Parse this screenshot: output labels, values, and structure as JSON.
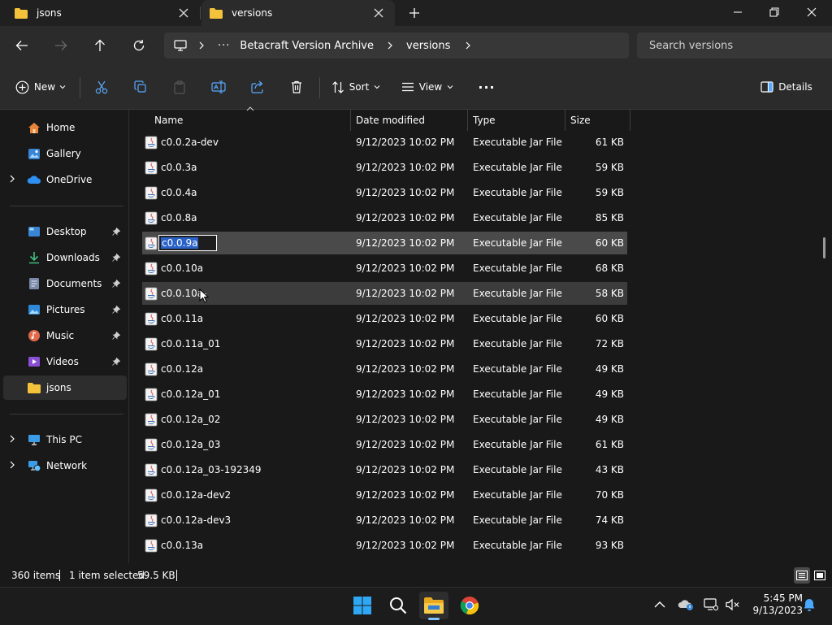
{
  "tabs": [
    {
      "label": "jsons",
      "active": false
    },
    {
      "label": "versions",
      "active": true
    }
  ],
  "address": {
    "breadcrumbs": [
      "Betacraft Version Archive",
      "versions"
    ],
    "overflow": "···"
  },
  "search": {
    "placeholder": "Search versions"
  },
  "commandbar": {
    "new_label": "New",
    "sort_label": "Sort",
    "view_label": "View",
    "more_label": "···",
    "details_label": "Details"
  },
  "sidebar": {
    "top": [
      {
        "label": "Home",
        "icon": "home-icon"
      },
      {
        "label": "Gallery",
        "icon": "gallery-icon"
      },
      {
        "label": "OneDrive",
        "icon": "onedrive-icon"
      }
    ],
    "pinned": [
      {
        "label": "Desktop",
        "icon": "desktop-icon"
      },
      {
        "label": "Downloads",
        "icon": "downloads-icon"
      },
      {
        "label": "Documents",
        "icon": "documents-icon"
      },
      {
        "label": "Pictures",
        "icon": "pictures-icon"
      },
      {
        "label": "Music",
        "icon": "music-icon"
      },
      {
        "label": "Videos",
        "icon": "videos-icon"
      },
      {
        "label": "jsons",
        "icon": "folder-icon"
      }
    ],
    "bottom": [
      {
        "label": "This PC",
        "icon": "this-pc-icon"
      },
      {
        "label": "Network",
        "icon": "network-icon"
      }
    ]
  },
  "columns": {
    "name": "Name",
    "date": "Date modified",
    "type": "Type",
    "size": "Size"
  },
  "files": [
    {
      "name": "c0.0.2a-dev",
      "date": "9/12/2023 10:02 PM",
      "type": "Executable Jar File",
      "size": "61 KB"
    },
    {
      "name": "c0.0.3a",
      "date": "9/12/2023 10:02 PM",
      "type": "Executable Jar File",
      "size": "59 KB"
    },
    {
      "name": "c0.0.4a",
      "date": "9/12/2023 10:02 PM",
      "type": "Executable Jar File",
      "size": "59 KB"
    },
    {
      "name": "c0.0.8a",
      "date": "9/12/2023 10:02 PM",
      "type": "Executable Jar File",
      "size": "85 KB"
    },
    {
      "name": "c0.0.9a",
      "date": "9/12/2023 10:02 PM",
      "type": "Executable Jar File",
      "size": "60 KB"
    },
    {
      "name": "c0.0.10a",
      "date": "9/12/2023 10:02 PM",
      "type": "Executable Jar File",
      "size": "68 KB"
    },
    {
      "name": "c0.0.10a-",
      "date": "9/12/2023 10:02 PM",
      "type": "Executable Jar File",
      "size": "58 KB"
    },
    {
      "name": "c0.0.11a",
      "date": "9/12/2023 10:02 PM",
      "type": "Executable Jar File",
      "size": "60 KB"
    },
    {
      "name": "c0.0.11a_01",
      "date": "9/12/2023 10:02 PM",
      "type": "Executable Jar File",
      "size": "72 KB"
    },
    {
      "name": "c0.0.12a",
      "date": "9/12/2023 10:02 PM",
      "type": "Executable Jar File",
      "size": "49 KB"
    },
    {
      "name": "c0.0.12a_01",
      "date": "9/12/2023 10:02 PM",
      "type": "Executable Jar File",
      "size": "49 KB"
    },
    {
      "name": "c0.0.12a_02",
      "date": "9/12/2023 10:02 PM",
      "type": "Executable Jar File",
      "size": "49 KB"
    },
    {
      "name": "c0.0.12a_03",
      "date": "9/12/2023 10:02 PM",
      "type": "Executable Jar File",
      "size": "61 KB"
    },
    {
      "name": "c0.0.12a_03-192349",
      "date": "9/12/2023 10:02 PM",
      "type": "Executable Jar File",
      "size": "43 KB"
    },
    {
      "name": "c0.0.12a-dev2",
      "date": "9/12/2023 10:02 PM",
      "type": "Executable Jar File",
      "size": "70 KB"
    },
    {
      "name": "c0.0.12a-dev3",
      "date": "9/12/2023 10:02 PM",
      "type": "Executable Jar File",
      "size": "74 KB"
    },
    {
      "name": "c0.0.13a",
      "date": "9/12/2023 10:02 PM",
      "type": "Executable Jar File",
      "size": "93 KB"
    }
  ],
  "rename_value": "c0.0.9a",
  "status": {
    "item_count": "360 items",
    "selection": "1 item selected",
    "selection_size": "59.5 KB"
  },
  "clock": {
    "time": "5:45 PM",
    "date": "9/13/2023"
  },
  "colors": {
    "accent": "#2a62c8",
    "folder": "#f3c33b",
    "background": "#191919",
    "chrome": "#2b2b2b"
  }
}
